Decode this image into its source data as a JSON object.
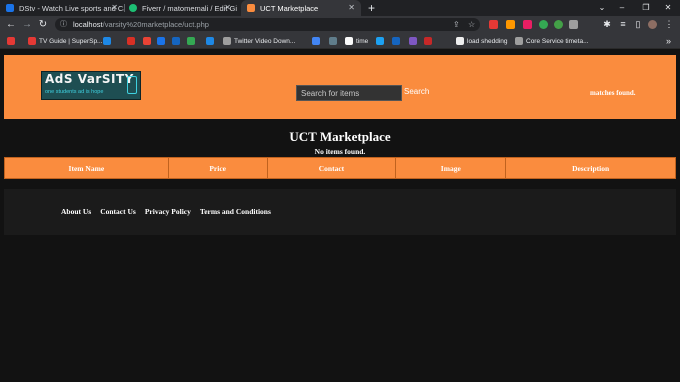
{
  "browser": {
    "tabs": [
      {
        "title": "DStv - Watch Live sports and Cat",
        "favicon_color": "#1a73e8"
      },
      {
        "title": "Fiverr / matomemali / Edit Gig",
        "favicon_color": "#1dbf73"
      },
      {
        "title": "UCT Marketplace",
        "favicon_color": "#fa8c3e"
      }
    ],
    "new_tab": "+",
    "window_controls": {
      "tab_search": "⌄",
      "minimize": "–",
      "maximize": "❐",
      "close": "✕"
    },
    "url_host": "localhost",
    "url_path": "/varsity%20marketplace/uct.php",
    "bookmarks": [
      {
        "label": "",
        "favicon_color": "#e53935"
      },
      {
        "label": "TV Guide | SuperSp...",
        "favicon_color": "#e53935"
      },
      {
        "label": "",
        "favicon_color": "#1e88e5"
      },
      {
        "label": "",
        "favicon_color": "#d93025"
      },
      {
        "label": "",
        "favicon_color": "#ea4335"
      },
      {
        "label": "",
        "favicon_color": "#1a73e8"
      },
      {
        "label": "",
        "favicon_color": "#1565c0"
      },
      {
        "label": "",
        "favicon_color": "#34a853"
      },
      {
        "label": "",
        "favicon_color": "#1e88e5"
      },
      {
        "label": "Twitter Video Down...",
        "favicon_color": "#9e9e9e"
      },
      {
        "label": "",
        "favicon_color": "#4285f4"
      },
      {
        "label": "",
        "favicon_color": "#607d8b"
      },
      {
        "label": "time",
        "favicon_color": "#fafafa"
      },
      {
        "label": "",
        "favicon_color": "#1da1f2"
      },
      {
        "label": "",
        "favicon_color": "#1565c0"
      },
      {
        "label": "",
        "favicon_color": "#7e57c2"
      },
      {
        "label": "",
        "favicon_color": "#c62828"
      },
      {
        "label": "load shedding",
        "favicon_color": "#eeeeee"
      },
      {
        "label": "Core Service timeta...",
        "favicon_color": "#9e9e9e"
      }
    ],
    "more_bookmarks": "»"
  },
  "header": {
    "logo_text": "AdS VarSITY",
    "logo_tagline": "one students ad is hope",
    "search_placeholder": "Search for items",
    "search_button": "Search",
    "matches_text": "matches found."
  },
  "main": {
    "title": "UCT Marketplace",
    "empty_message": "No items found.",
    "columns": [
      "Item Name",
      "Price",
      "Contact",
      "Image",
      "Description"
    ]
  },
  "footer": {
    "links": [
      "About Us",
      "Contact Us",
      "Privacy Policy",
      "Terms and Conditions"
    ]
  },
  "colors": {
    "accent": "#fa8c3e",
    "background": "#121212",
    "footer_bg": "#1b1b1b",
    "logo_bg": "#1e4e52"
  }
}
